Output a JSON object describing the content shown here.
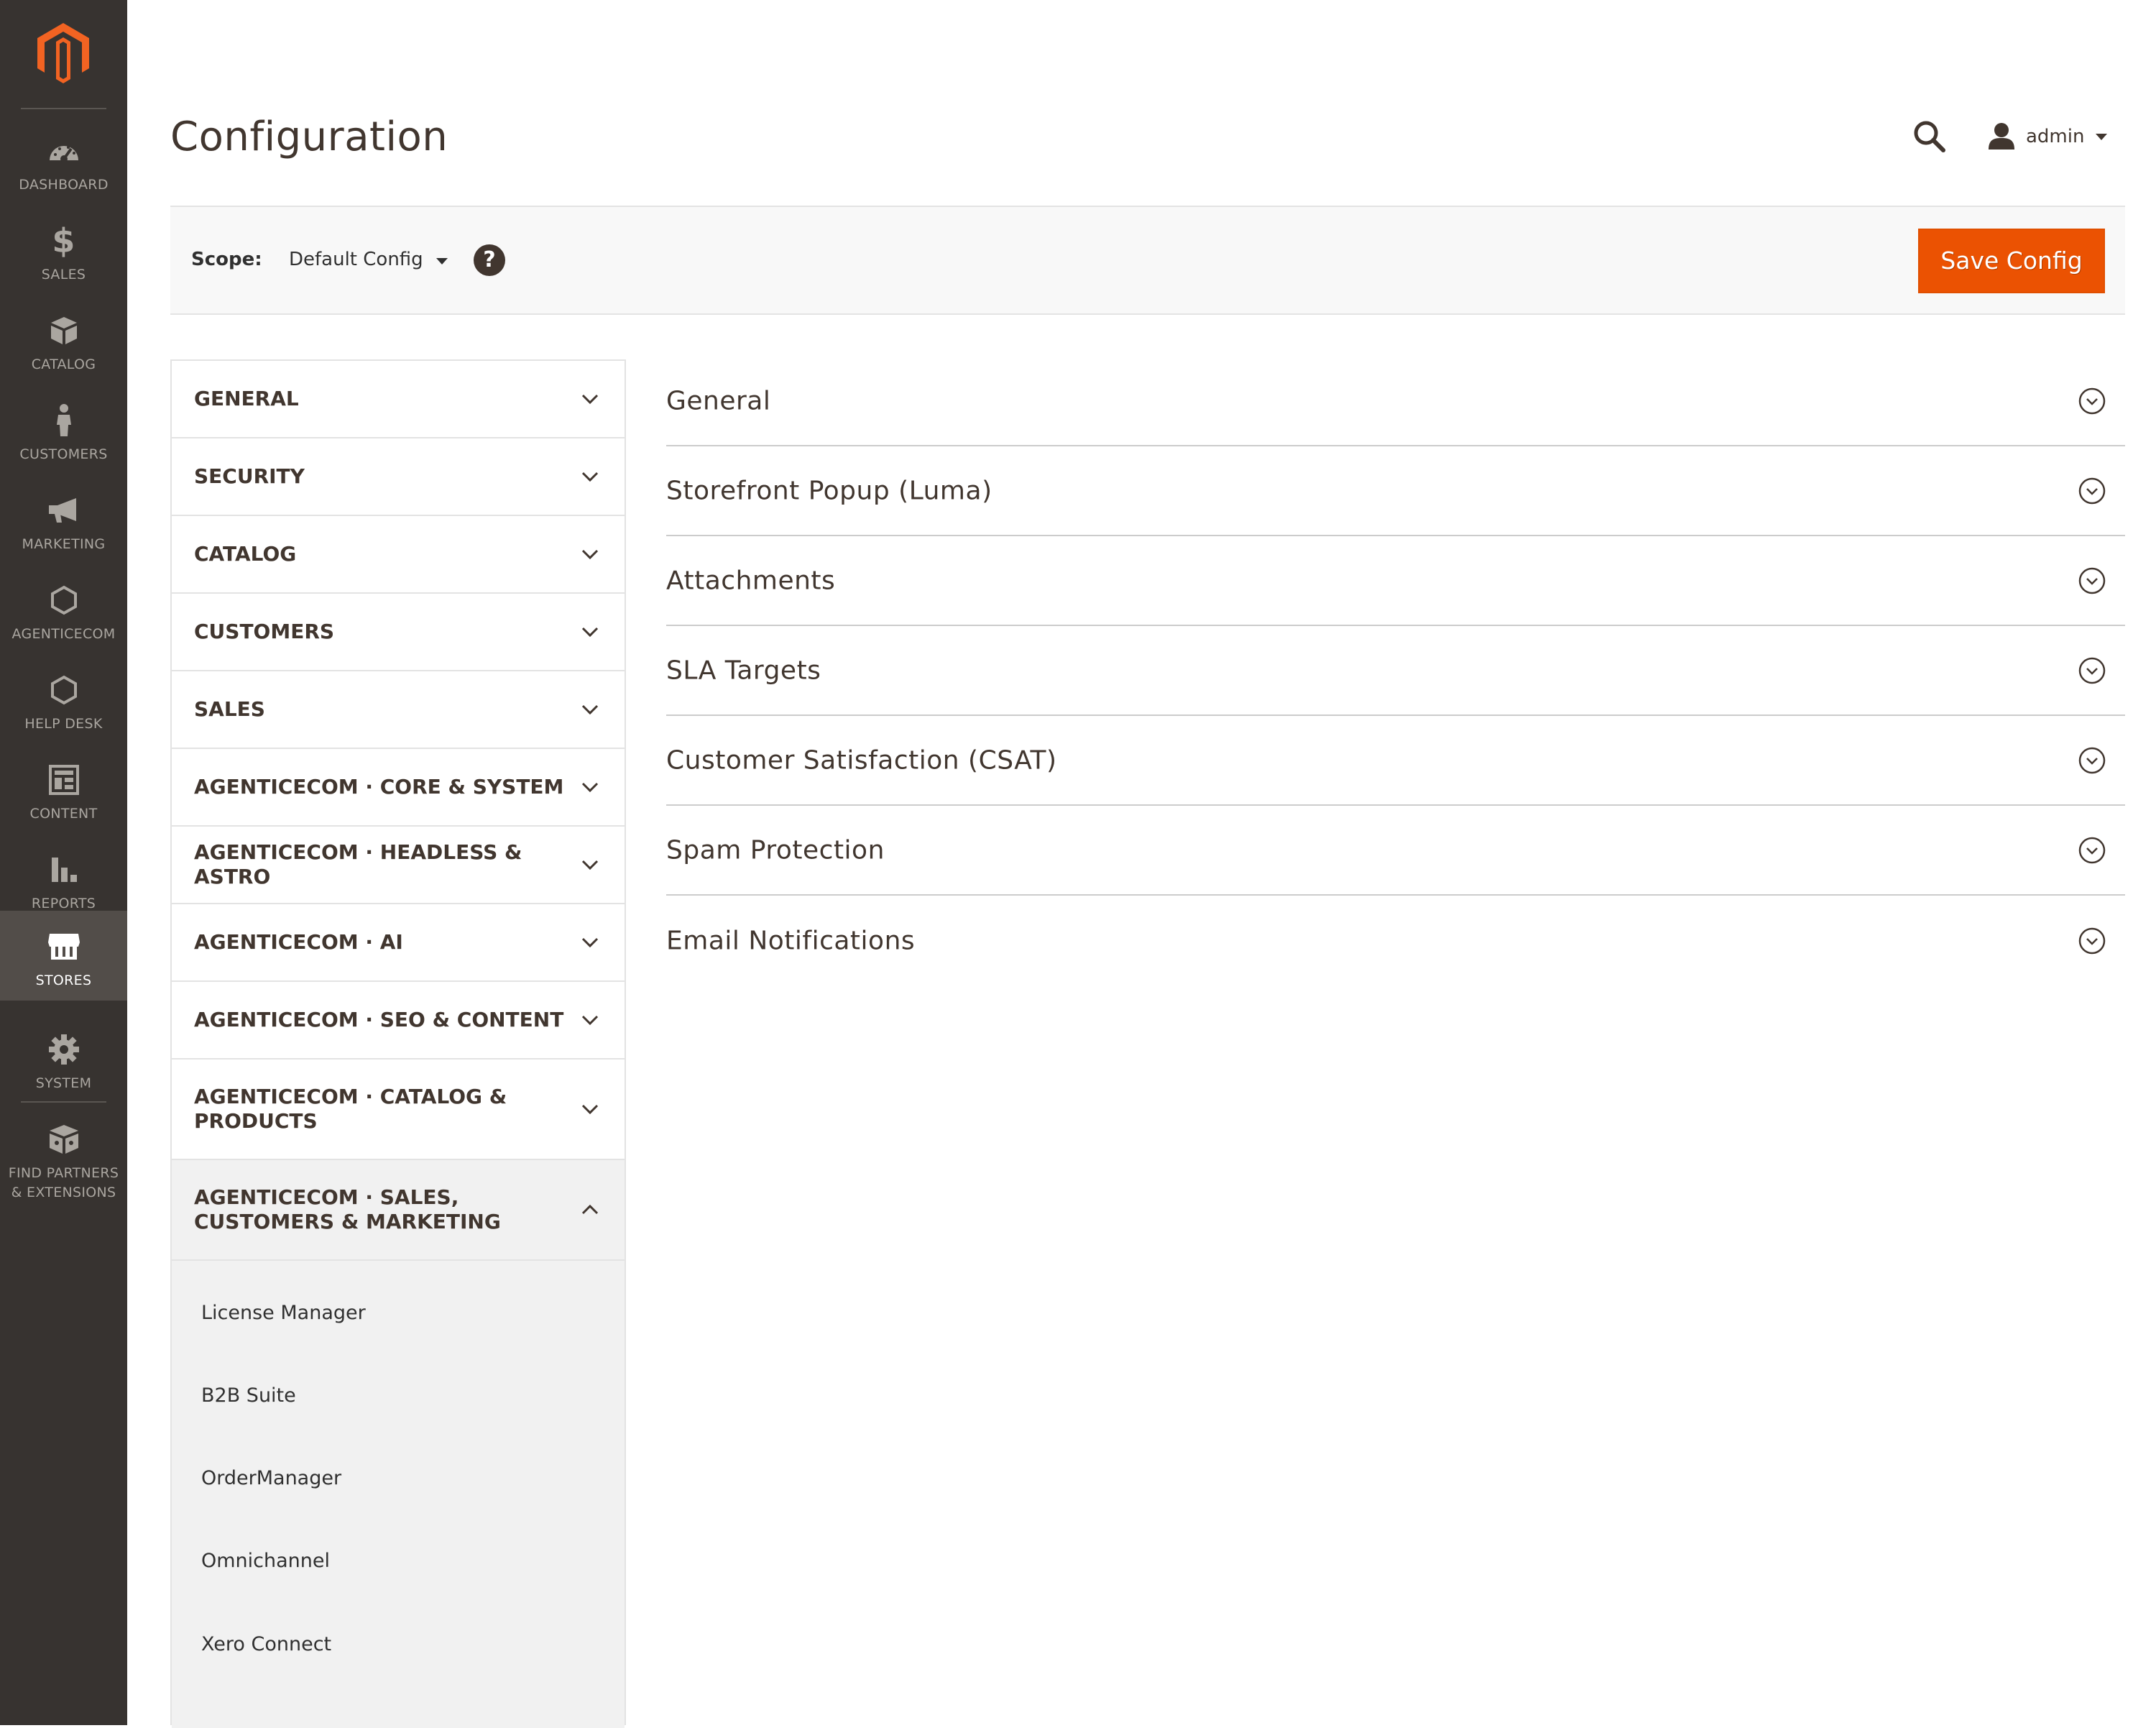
{
  "admin_nav": {
    "items": [
      {
        "label": "Dashboard",
        "icon": "dashboard-icon"
      },
      {
        "label": "Sales",
        "icon": "dollar-icon"
      },
      {
        "label": "Catalog",
        "icon": "box-icon"
      },
      {
        "label": "Customers",
        "icon": "person-icon"
      },
      {
        "label": "Marketing",
        "icon": "megaphone-icon"
      },
      {
        "label": "AgenticEcom",
        "icon": "hexagon-icon"
      },
      {
        "label": "Help Desk",
        "icon": "hexagon-icon"
      },
      {
        "label": "Content",
        "icon": "layout-icon"
      },
      {
        "label": "Reports",
        "icon": "bar-chart-icon"
      },
      {
        "label": "Stores",
        "icon": "storefront-icon",
        "active": true
      },
      {
        "label": "System",
        "icon": "gear-icon"
      },
      {
        "label": "Find Partners & Extensions",
        "icon": "puzzle-icon"
      }
    ]
  },
  "header": {
    "title": "Configuration",
    "user": "admin"
  },
  "scope": {
    "label": "Scope:",
    "value": "Default Config",
    "help_glyph": "?",
    "save_label": "Save Config"
  },
  "config_tabs": [
    {
      "label": "General",
      "expanded": false
    },
    {
      "label": "Security",
      "expanded": false
    },
    {
      "label": "Catalog",
      "expanded": false
    },
    {
      "label": "Customers",
      "expanded": false
    },
    {
      "label": "Sales",
      "expanded": false
    },
    {
      "label": "AgenticEcom · Core & System",
      "expanded": false
    },
    {
      "label": "AgenticEcom · Headless & Astro",
      "expanded": false
    },
    {
      "label": "AgenticEcom · AI",
      "expanded": false
    },
    {
      "label": "AgenticEcom · SEO & Content",
      "expanded": false
    },
    {
      "label": "AgenticEcom · Catalog & Products",
      "expanded": false
    },
    {
      "label": "AgenticEcom · Sales, Customers & Marketing",
      "expanded": true
    }
  ],
  "sub_items": [
    "License Manager",
    "B2B Suite",
    "OrderManager",
    "Omnichannel",
    "Xero Connect"
  ],
  "sections": [
    "General",
    "Storefront Popup (Luma)",
    "Attachments",
    "SLA Targets",
    "Customer Satisfaction (CSAT)",
    "Spam Protection",
    "Email Notifications"
  ],
  "colors": {
    "nav_bg": "#373330",
    "nav_active": "#524d49",
    "accent": "#eb5202",
    "logo": "#f26322"
  }
}
